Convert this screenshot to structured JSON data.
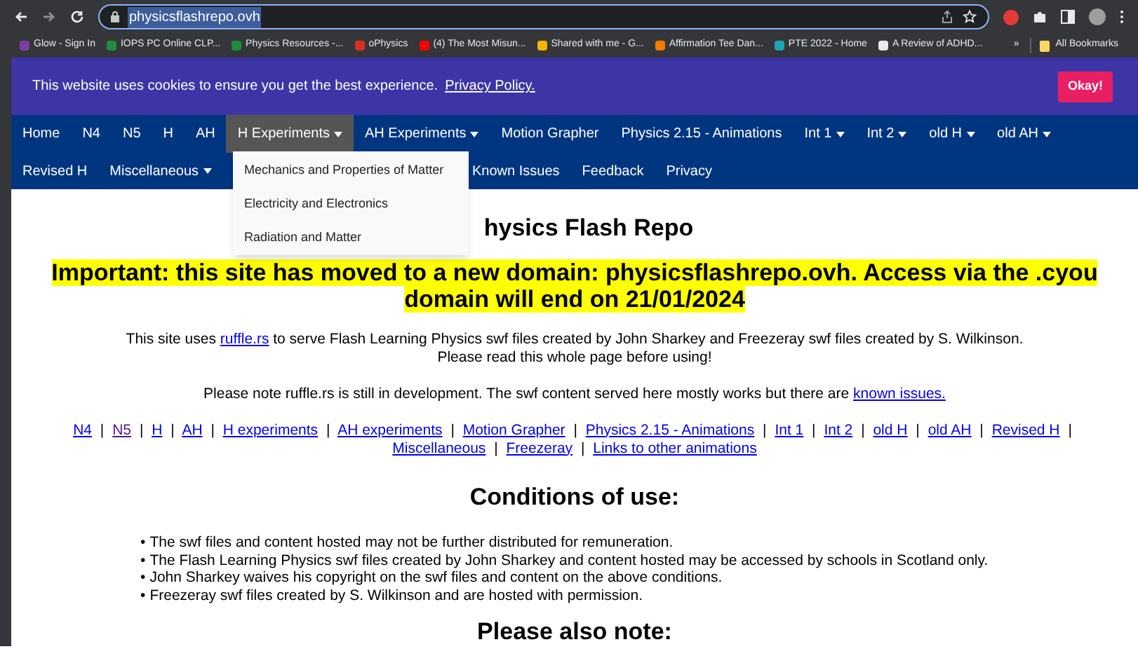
{
  "browser": {
    "url": "physicsflashrepo.ovh",
    "bookmarks": [
      {
        "label": "Glow - Sign In",
        "color": "#7b3fa0"
      },
      {
        "label": "IOPS PC Online CLP...",
        "color": "#1e8e3e"
      },
      {
        "label": "Physics Resources -...",
        "color": "#1e8e3e"
      },
      {
        "label": "oPhysics",
        "color": "#d93025"
      },
      {
        "label": "(4) The Most Misun...",
        "color": "#ff0000"
      },
      {
        "label": "Shared with me - G...",
        "color": "#f4b400"
      },
      {
        "label": "Affirmation Tee Dan...",
        "color": "#f57c00"
      },
      {
        "label": "PTE 2022 - Home",
        "color": "#1aa6b7"
      },
      {
        "label": "A Review of ADHD...",
        "color": "#e8eaed"
      }
    ],
    "more": "»",
    "all_bookmarks": "All Bookmarks"
  },
  "cookie_banner": {
    "text": "This website uses cookies to ensure you get the best experience.",
    "link": "Privacy Policy.",
    "button": "Okay!"
  },
  "nav": {
    "line_1": [
      {
        "label": "Home",
        "dropdown": false,
        "selected": false
      },
      {
        "label": "N4",
        "dropdown": false,
        "selected": false
      },
      {
        "label": "N5",
        "dropdown": false,
        "selected": false
      },
      {
        "label": "H",
        "dropdown": false,
        "selected": false
      },
      {
        "label": "AH",
        "dropdown": false,
        "selected": false
      },
      {
        "label": "H Experiments",
        "dropdown": true,
        "selected": true
      },
      {
        "label": "AH Experiments",
        "dropdown": true,
        "selected": false
      },
      {
        "label": "Motion Grapher",
        "dropdown": false,
        "selected": false
      },
      {
        "label": "Physics 2.15 - Animations",
        "dropdown": false,
        "selected": false
      },
      {
        "label": "Int 1",
        "dropdown": true,
        "selected": false
      },
      {
        "label": "Int 2",
        "dropdown": true,
        "selected": false
      },
      {
        "label": "old H",
        "dropdown": true,
        "selected": false
      },
      {
        "label": "old AH",
        "dropdown": true,
        "selected": false
      }
    ],
    "line_2": [
      {
        "label": "Revised H",
        "dropdown": false,
        "selected": false
      },
      {
        "label": "Miscellaneous",
        "dropdown": true,
        "selected": false
      },
      {
        "label": "Known Issues",
        "dropdown": false,
        "selected": false
      },
      {
        "label": "Feedback",
        "dropdown": false,
        "selected": false
      },
      {
        "label": "Privacy",
        "dropdown": false,
        "selected": false
      }
    ],
    "dropdown_menu": [
      "Mechanics and Properties of Matter",
      "Electricity and Electronics",
      "Radiation and Matter"
    ]
  },
  "heading": "hysics Flash Repo",
  "notice": "Important: this site has moved to a new domain: physicsflashrepo.ovh. Access via the .cyou domain will end on 21/01/2024",
  "intro": {
    "before": "This site uses ",
    "link": "ruffle.rs",
    "after": " to serve Flash Learning Physics swf files created by John Sharkey and Freezeray swf files created by S. Wilkinson.",
    "line2": "Please read this whole page before using!"
  },
  "note": {
    "text": "Please note ruffle.rs is still in development. The swf content served here mostly works but there are ",
    "link": "known issues."
  },
  "quick_links": [
    {
      "label": "N4",
      "visited": false
    },
    {
      "label": "N5",
      "visited": true
    },
    {
      "label": "H",
      "visited": false
    },
    {
      "label": "AH",
      "visited": false
    },
    {
      "label": "H experiments",
      "visited": false
    },
    {
      "label": "AH experiments",
      "visited": false
    },
    {
      "label": "Motion Grapher",
      "visited": false
    },
    {
      "label": "Physics 2.15 - Animations",
      "visited": false
    },
    {
      "label": "Int 1",
      "visited": false
    },
    {
      "label": "Int 2",
      "visited": false
    },
    {
      "label": "old H",
      "visited": false
    },
    {
      "label": "old AH",
      "visited": false
    },
    {
      "label": "Revised H",
      "visited": false
    },
    {
      "label": "Miscellaneous",
      "visited": false
    },
    {
      "label": "Freezeray",
      "visited": false
    },
    {
      "label": "Links to other animations",
      "visited": false
    }
  ],
  "separator": "|",
  "conditions": {
    "title": "Conditions of use:",
    "items": [
      "The swf files and content hosted may not be further distributed for remuneration.",
      "The Flash Learning Physics swf files created by John Sharkey and content hosted may be accessed by schools in Scotland only.",
      "John Sharkey waives his copyright on the swf files and content on the above conditions.",
      "Freezeray swf files created by S. Wilkinson and are hosted with permission."
    ],
    "bullet": "•"
  },
  "next_heading": "Please also note:"
}
